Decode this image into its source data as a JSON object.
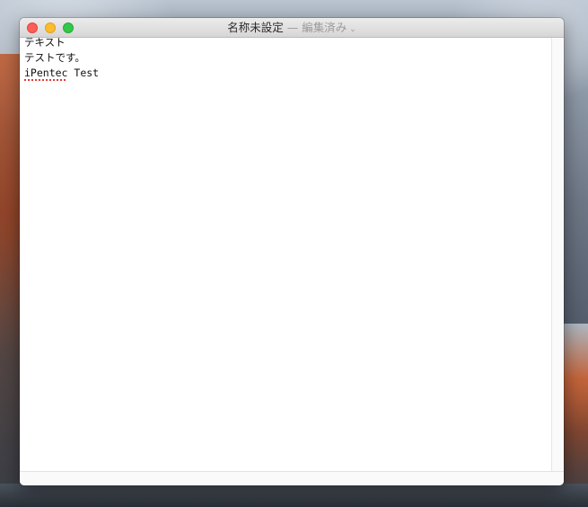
{
  "window": {
    "title": "名称未設定",
    "separator": "—",
    "state": "編集済み",
    "chevron": "⌄"
  },
  "editor": {
    "lines": [
      {
        "text": "テキスト"
      },
      {
        "text": "テストです。"
      },
      {
        "misspelled_word": "iPentec",
        "rest": " Test"
      }
    ]
  },
  "colors": {
    "close": "#fc5f57",
    "minimize": "#fdbc2e",
    "zoom": "#34c84a",
    "spell_underline": "#e53935"
  },
  "icons": {
    "close": "close-icon",
    "minimize": "minimize-icon",
    "zoom": "zoom-icon",
    "title_menu": "chevron-down-icon"
  }
}
